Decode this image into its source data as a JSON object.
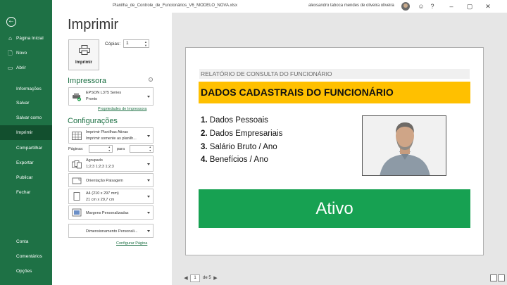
{
  "window": {
    "file_name": "Planilha_de_Controle_de_Funcionários_V6_MODELO_NOVA.xlsx",
    "user_name": "alexsandro taboca mendes de oliveira oliveira",
    "icons": [
      "back-arrow-icon",
      "smiley-icon",
      "help-icon",
      "minimize-icon",
      "maximize-icon",
      "close-icon"
    ]
  },
  "nav": {
    "items": [
      {
        "label": "Página Inicial",
        "icon": "home-icon"
      },
      {
        "label": "Novo",
        "icon": "new-document-icon"
      },
      {
        "label": "Abrir",
        "icon": "folder-open-icon"
      },
      {
        "label": "Informações"
      },
      {
        "label": "Salvar"
      },
      {
        "label": "Salvar como"
      },
      {
        "label": "Imprimir",
        "selected": true
      },
      {
        "label": "Compartilhar"
      },
      {
        "label": "Exportar"
      },
      {
        "label": "Publicar"
      },
      {
        "label": "Fechar"
      },
      {
        "label": "Conta"
      },
      {
        "label": "Comentários"
      },
      {
        "label": "Opções"
      }
    ]
  },
  "print": {
    "heading": "Imprimir",
    "button_label": "Imprimir",
    "copies_label": "Cópias:",
    "copies_value": "1"
  },
  "printer": {
    "section_title": "Impressora",
    "name": "EPSON L375 Series",
    "status": "Pronto",
    "properties_link": "Propriedades de Impressora"
  },
  "settings": {
    "section_title": "Configurações",
    "what": {
      "line1": "Imprimir Planilhas Ativas",
      "line2": "Imprimir somente as planilh..."
    },
    "pages_label": "Páginas:",
    "pages_to_label": "para",
    "collation": {
      "line1": "Agrupado",
      "line2": "1;2;3    1;2;3    1;2;3"
    },
    "orientation": "Orientação Paisagem",
    "paper": {
      "line1": "A4 (210 x 297 mm)",
      "line2": "21 cm x 29,7 cm"
    },
    "margins": "Margens Personalizadas",
    "scaling": "Dimensionamento Personali...",
    "page_setup_link": "Configurar Página"
  },
  "preview": {
    "report_title": "RELATÓRIO DE CONSULTA DO FUNCIONÁRIO",
    "data_title": "DADOS CADASTRAIS DO FUNCIONÁRIO",
    "menu": [
      {
        "num": "1.",
        "text": " Dados Pessoais"
      },
      {
        "num": "2.",
        "text": " Dados Empresariais"
      },
      {
        "num": "3.",
        "text": " Salário Bruto / Ano"
      },
      {
        "num": "4.",
        "text": " Benefícios / Ano"
      }
    ],
    "status": "Ativo",
    "colors": {
      "yellow_band": "#ffc000",
      "green_band": "#17a152",
      "nav_green": "#1e7145"
    }
  },
  "pager": {
    "current_page": "1",
    "of_text": "de 5"
  }
}
